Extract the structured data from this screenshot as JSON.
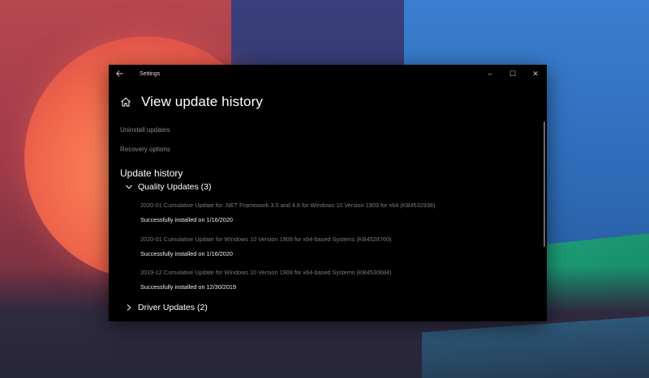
{
  "window": {
    "app_title": "Settings",
    "controls": {
      "minimize": "–",
      "maximize": "☐",
      "close": "✕"
    }
  },
  "page": {
    "title": "View update history",
    "links": {
      "uninstall": "Uninstall updates",
      "recovery": "Recovery options"
    },
    "section_title": "Update history"
  },
  "groups": {
    "quality": {
      "label": "Quality Updates (3)",
      "expanded": true,
      "items": [
        {
          "name": "2020-01 Cumulative Update for .NET Framework 3.5 and 4.8 for Windows 10 Version 1909 for x64 (KB4532938)",
          "status": "Successfully installed on 1/16/2020"
        },
        {
          "name": "2020-01 Cumulative Update for Windows 10 Version 1909 for x64-based Systems (KB4528760)",
          "status": "Successfully installed on 1/16/2020"
        },
        {
          "name": "2019-12 Cumulative Update for Windows 10 Version 1909 for x64-based Systems (KB4530684)",
          "status": "Successfully installed on 12/30/2019"
        }
      ]
    },
    "driver": {
      "label": "Driver Updates (2)",
      "expanded": false
    }
  },
  "icons": {
    "back": "back-arrow-icon",
    "home": "home-icon",
    "expand": "chevron-down-icon",
    "collapsed": "chevron-right-icon"
  },
  "colors": {
    "window_bg": "#000000",
    "link_text": "#8a8a8a",
    "update_name_text": "#7c7c7c"
  }
}
